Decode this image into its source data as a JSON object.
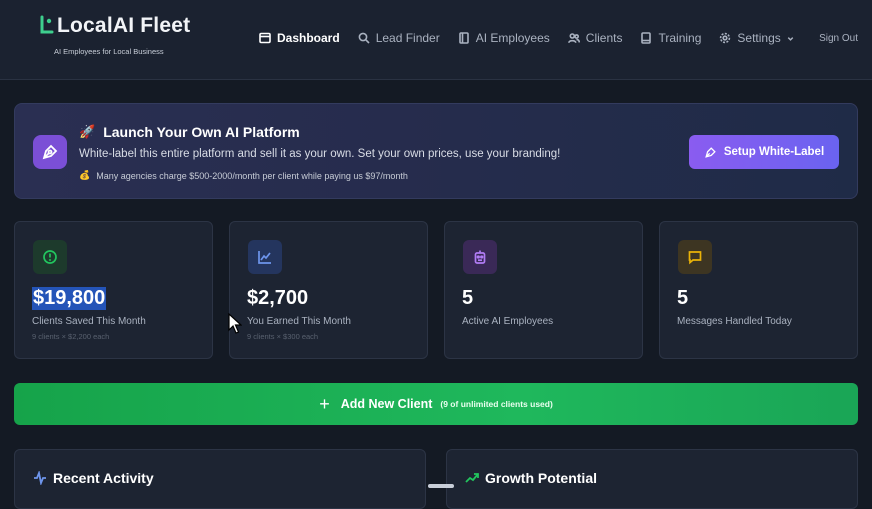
{
  "header": {
    "brand_title": "LocalAI Fleet",
    "brand_tagline": "AI Employees for Local Business",
    "nav": [
      {
        "label": "Dashboard",
        "icon": "layout-icon",
        "active": true
      },
      {
        "label": "Lead Finder",
        "icon": "search-icon",
        "active": false
      },
      {
        "label": "AI Employees",
        "icon": "document-icon",
        "active": false
      },
      {
        "label": "Clients",
        "icon": "users-icon",
        "active": false
      },
      {
        "label": "Training",
        "icon": "book-icon",
        "active": false
      },
      {
        "label": "Settings",
        "icon": "gear-icon",
        "active": false
      }
    ],
    "sign_out": "Sign Out"
  },
  "banner": {
    "title": "Launch Your Own AI Platform",
    "description": "White-label this entire platform and sell it as your own. Set your own prices, use your branding!",
    "note": "Many agencies charge $500-2000/month per client while paying us $97/month",
    "button": "Setup White-Label"
  },
  "stats": [
    {
      "value": "$19,800",
      "label": "Clients Saved This Month",
      "sub": "9 clients × $2,200 each",
      "icon": "clock-icon",
      "color": "#22c55e"
    },
    {
      "value": "$2,700",
      "label": "You Earned This Month",
      "sub": "9 clients × $300 each",
      "icon": "chart-line-icon",
      "color": "#4f7fe8"
    },
    {
      "value": "5",
      "label": "Active AI Employees",
      "sub": "",
      "icon": "robot-icon",
      "color": "#a855f7"
    },
    {
      "value": "5",
      "label": "Messages Handled Today",
      "sub": "",
      "icon": "message-icon",
      "color": "#eab308"
    }
  ],
  "add_client": {
    "label": "Add New Client",
    "meta": "(9 of unlimited clients used)"
  },
  "panels": {
    "recent_activity": "Recent Activity",
    "growth_potential": "Growth Potential"
  },
  "colors": {
    "accent_purple": "#8a5cf0",
    "success_green": "#16a34a",
    "background": "#141a24"
  }
}
